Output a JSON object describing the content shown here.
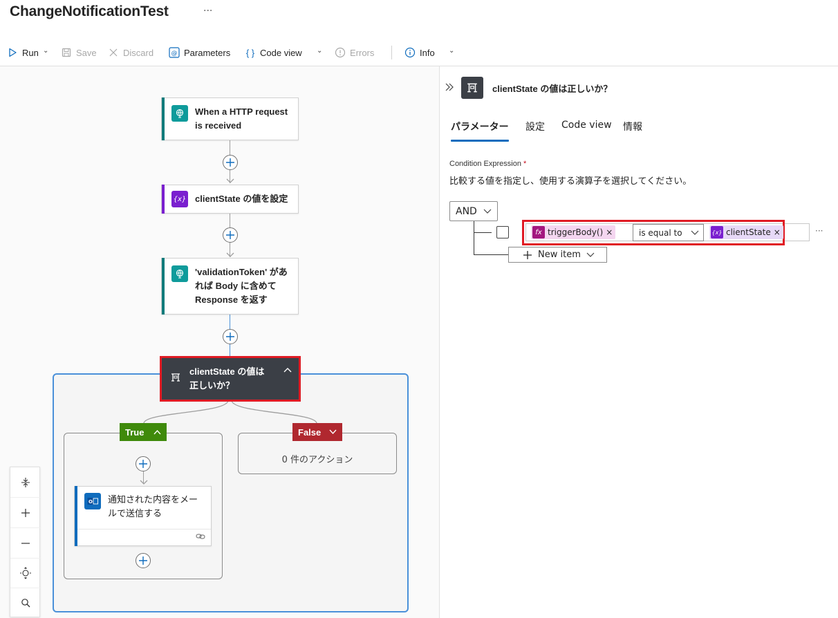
{
  "app": {
    "title": "ChangeNotificationTest",
    "more": "···"
  },
  "toolbar": {
    "run": "Run",
    "save": "Save",
    "discard": "Discard",
    "parameters": "Parameters",
    "code_view": "Code view",
    "errors": "Errors",
    "info": "Info"
  },
  "canvas": {
    "nodes": [
      {
        "label_line1": "When a HTTP request",
        "label_line2": "is received",
        "icon": "globe-icon",
        "color": "#0f9b9b"
      },
      {
        "label_line1": "clientState の値を設定",
        "icon": "variable-icon",
        "color": "#7a1fcf"
      },
      {
        "label_line1": "'validationToken' があ",
        "label_line2": "れば Body に含めて",
        "label_line3": "Response を返す",
        "icon": "globe-icon",
        "color": "#0f9b9b"
      }
    ],
    "condition": {
      "line1": "clientState の値は",
      "line2": "正しいか？",
      "icon": "condition-icon",
      "highlight_color": "#e01b24"
    },
    "true_branch": {
      "label": "True",
      "color": "#3f8a0b",
      "action": {
        "line1": "通知された内容をメー",
        "line2": "ルで送信する",
        "icon": "outlook-icon",
        "color": "#0f6cbd"
      }
    },
    "false_branch": {
      "label": "False",
      "color": "#b0282f",
      "empty_text": "0 件のアクション"
    }
  },
  "panel": {
    "title": "clientState の値は正しいか？",
    "tabs": [
      "パラメーター",
      "設定",
      "Code view",
      "情報"
    ],
    "active_tab": "パラメーター",
    "section_label": "Condition Expression",
    "required_marker": "*",
    "description": "比較する値を指定し、使用する演算子を選択してください。",
    "group_operator": "AND",
    "row": {
      "left_token": "triggerBody()",
      "operator": "is equal to",
      "right_token": "clientState",
      "remove": "×",
      "more": "···"
    },
    "new_item": "New item"
  }
}
